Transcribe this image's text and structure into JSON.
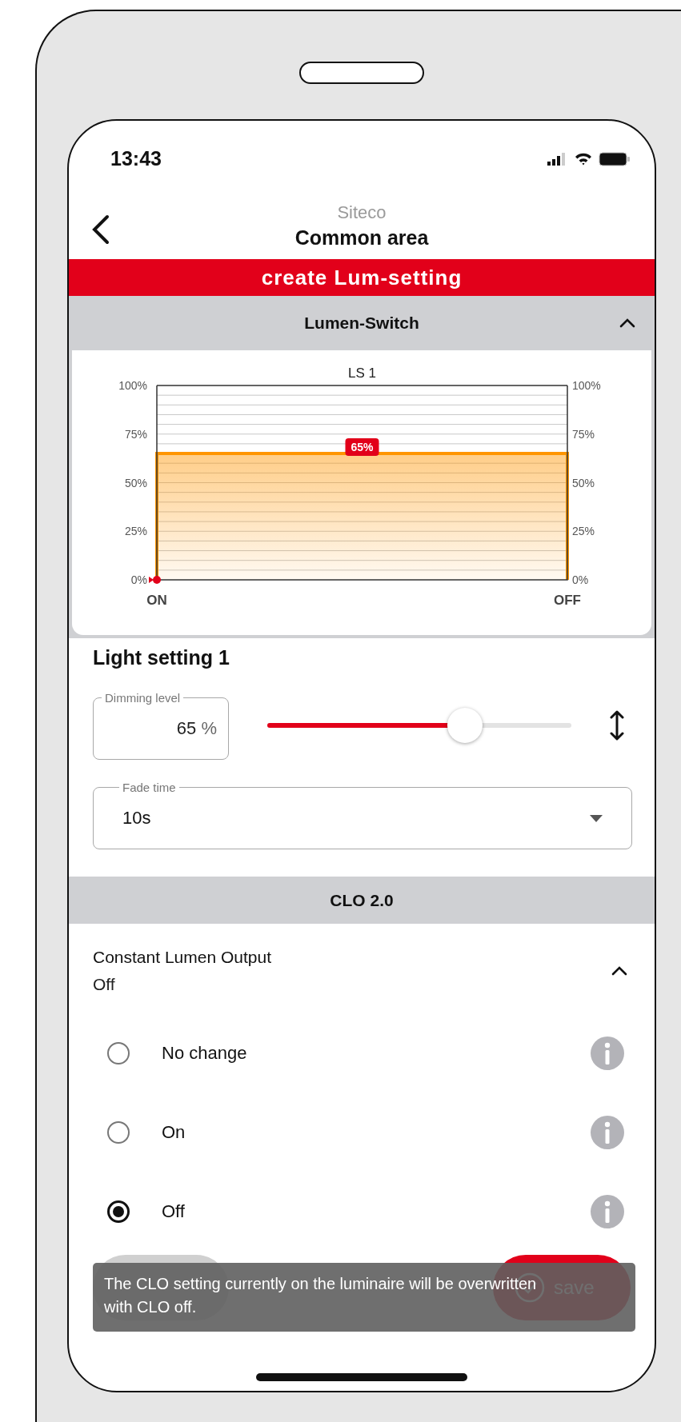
{
  "status_bar": {
    "time": "13:43"
  },
  "nav": {
    "subtitle": "Siteco",
    "title": "Common area"
  },
  "banner": {
    "title": "create Lum-setting"
  },
  "lumen_switch": {
    "title": "Lumen-Switch",
    "expanded": true,
    "chart_data": {
      "type": "area",
      "title": "LS 1",
      "categories": [
        "ON",
        "OFF"
      ],
      "series": [
        {
          "color": "#ff9500",
          "values": [
            65,
            65
          ]
        }
      ],
      "ylim": [
        0,
        100
      ],
      "yticks": [
        {
          "value": 0,
          "label": "0%"
        },
        {
          "value": 25,
          "label": "25%"
        },
        {
          "value": 50,
          "label": "50%"
        },
        {
          "value": 75,
          "label": "75%"
        },
        {
          "value": 100,
          "label": "100%"
        }
      ],
      "value_labels": [
        "65%"
      ]
    }
  },
  "light_setting": {
    "title": "Light setting 1",
    "dimming": {
      "label": "Dimming level",
      "value": "65",
      "unit": "%",
      "level": 0.65
    },
    "fade_time": {
      "label": "Fade time",
      "value": "10s"
    }
  },
  "clo": {
    "title": "CLO 2.0",
    "setting": {
      "label": "Constant Lumen Output",
      "value": "Off",
      "expanded": true
    },
    "options": [
      {
        "label": "No change",
        "selected": false
      },
      {
        "label": "On",
        "selected": false
      },
      {
        "label": "Off",
        "selected": true
      }
    ]
  },
  "buttons": [
    {
      "kind": "back"
    },
    {
      "kind": "save",
      "label": "save"
    }
  ],
  "toast": {
    "text": "The CLO setting currently on the luminaire will be overwritten with CLO off."
  }
}
